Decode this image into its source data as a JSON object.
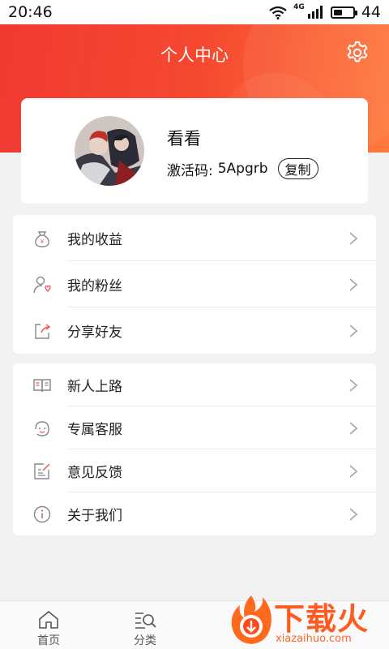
{
  "status_bar": {
    "time": "20:46",
    "network": "4G",
    "battery": "44",
    "battery_level": 0.44
  },
  "header": {
    "title": "个人中心",
    "settings_icon": "gear-icon"
  },
  "profile": {
    "name": "看看",
    "activation_label": "激活码:",
    "activation_code": "5Apgrb",
    "copy_label": "复制"
  },
  "menu_group_1": [
    {
      "label": "我的收益",
      "icon": "money-bag-icon"
    },
    {
      "label": "我的粉丝",
      "icon": "user-heart-icon"
    },
    {
      "label": "分享好友",
      "icon": "share-icon"
    }
  ],
  "menu_group_2": [
    {
      "label": "新人上路",
      "icon": "book-icon"
    },
    {
      "label": "专属客服",
      "icon": "customer-service-icon"
    },
    {
      "label": "意见反馈",
      "icon": "feedback-icon"
    },
    {
      "label": "关于我们",
      "icon": "info-icon"
    }
  ],
  "bottom_nav": [
    {
      "label": "首页",
      "icon": "home-icon"
    },
    {
      "label": "分类",
      "icon": "category-search-icon"
    }
  ],
  "watermark": {
    "text": "下载火",
    "url": "xiazaihuo.com"
  },
  "colors": {
    "accent": "#f03a32",
    "accent_end": "#ff7a3e",
    "watermark": "#ff5a1f"
  }
}
